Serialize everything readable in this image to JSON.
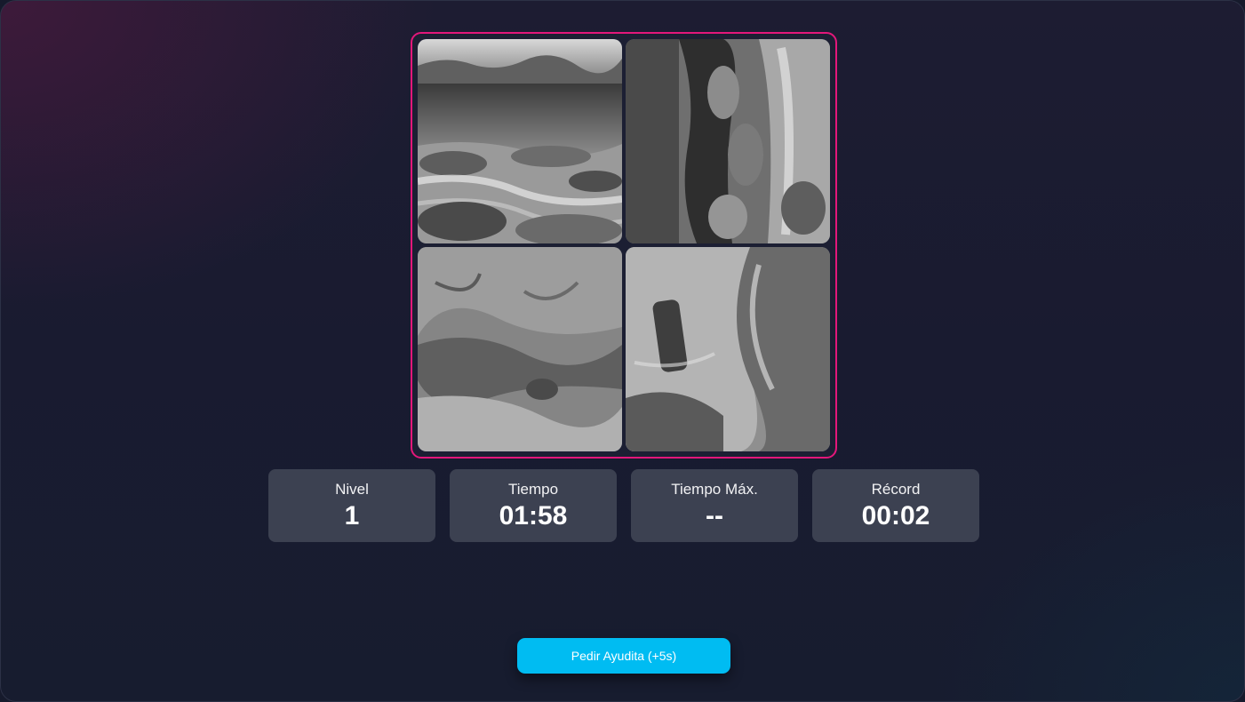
{
  "board": {
    "tiles": [
      {
        "image": "river-rocks-photo-segment",
        "tone": "grayscale"
      },
      {
        "image": "river-rocks-photo-segment-rotated",
        "tone": "grayscale"
      },
      {
        "image": "rock-texture-photo-segment",
        "tone": "grayscale"
      },
      {
        "image": "water-and-boulder-photo-segment-rotated",
        "tone": "grayscale"
      }
    ],
    "border_color": "#e3177a"
  },
  "stats": [
    {
      "label": "Nivel",
      "value": "1"
    },
    {
      "label": "Tiempo",
      "value": "01:58"
    },
    {
      "label": "Tiempo Máx.",
      "value": "--"
    },
    {
      "label": "Récord",
      "value": "00:02"
    }
  ],
  "help_button": {
    "label": "Pedir Ayudita (+5s)",
    "color": "#00bcf2"
  }
}
